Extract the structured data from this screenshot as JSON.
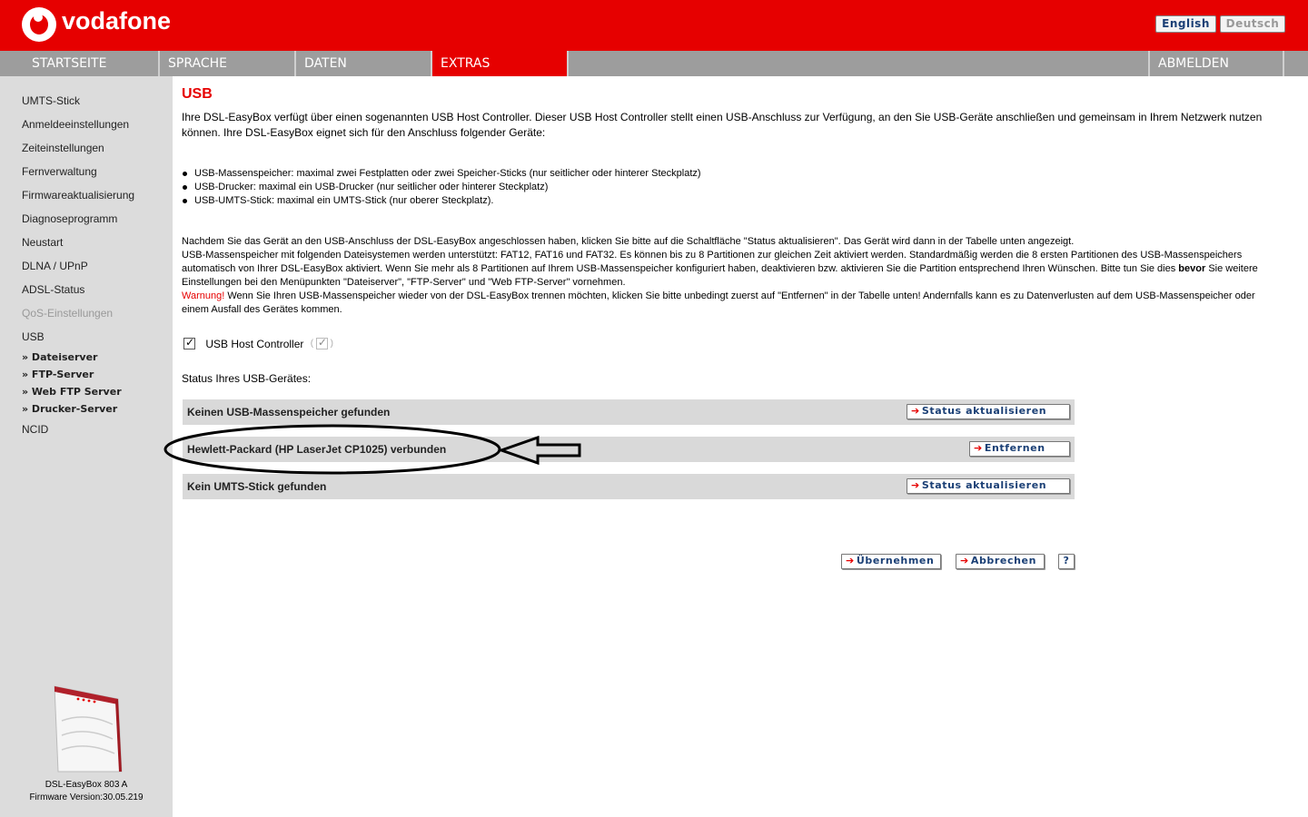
{
  "header": {
    "brand": "vodafone",
    "lang_en": "English",
    "lang_de": "Deutsch"
  },
  "nav": {
    "items": [
      "STARTSEITE",
      "SPRACHE",
      "DATEN",
      "EXTRAS"
    ],
    "active": "EXTRAS",
    "logout": "ABMELDEN"
  },
  "sidebar": {
    "items": [
      "UMTS-Stick",
      "Anmeldeeinstellungen",
      "Zeiteinstellungen",
      "Fernverwaltung",
      "Firmwareaktualisierung",
      "Diagnoseprogramm",
      "Neustart",
      "DLNA / UPnP",
      "ADSL-Status",
      "QoS-Einstellungen",
      "USB"
    ],
    "disabled_item": "QoS-Einstellungen",
    "subitems": [
      "» Dateiserver",
      "» FTP-Server",
      "» Web FTP Server",
      "» Drucker-Server"
    ],
    "last_item": "NCID",
    "device_name": "DSL-EasyBox 803 A",
    "firmware": "Firmware Version:30.05.219"
  },
  "main": {
    "title": "USB",
    "intro": "Ihre DSL-EasyBox verfügt über einen sogenannten USB Host Controller. Dieser USB Host Controller stellt einen USB-Anschluss zur Verfügung, an den Sie USB-Geräte anschließen und gemeinsam in Ihrem Netzwerk nutzen können. Ihre DSL-EasyBox eignet sich für den Anschluss folgender Geräte:",
    "bullets": [
      "USB-Massenspeicher: maximal zwei Festplatten oder zwei Speicher-Sticks (nur seitlicher oder hinterer Steckplatz)",
      "USB-Drucker: maximal ein USB-Drucker (nur seitlicher oder hinterer Steckplatz)",
      "USB-UMTS-Stick: maximal ein UMTS-Stick (nur oberer Steckplatz)."
    ],
    "info_1": "Nachdem Sie das Gerät an den USB-Anschluss der DSL-EasyBox angeschlossen haben, klicken Sie bitte auf die Schaltfläche \"Status aktualisieren\". Das Gerät wird dann in der Tabelle unten angezeigt.",
    "info_2a": "USB-Massenspeicher mit folgenden Dateisystemen werden unterstützt: FAT12, FAT16 und FAT32. Es können bis zu 8 Partitionen zur gleichen Zeit aktiviert werden. Standardmäßig werden die 8 ersten Partitionen des USB-Massenspeichers automatisch von Ihrer DSL-EasyBox aktiviert. Wenn Sie mehr als 8 Partitionen auf Ihrem USB-Massenspeicher konfiguriert haben, deaktivieren bzw. aktivieren Sie die Partition entsprechend Ihren Wünschen. Bitte tun Sie dies ",
    "info_2_bold": "bevor",
    "info_2b": " Sie weitere Einstellungen bei den Menüpunkten \"Dateiserver\", \"FTP-Server\" und \"Web FTP-Server\" vornehmen.",
    "warning_label": "Warnung!",
    "warning_text": " Wenn Sie Ihren USB-Massenspeicher wieder von der DSL-EasyBox trennen möchten, klicken Sie bitte unbedingt zuerst auf \"Entfernen\" in der Tabelle unten! Andernfalls kann es zu Datenverlusten auf dem USB-Massenspeicher oder einem Ausfall des Gerätes kommen.",
    "controller_label": "USB Host Controller",
    "controller_paren_open": "(",
    "controller_paren_close": ")",
    "status_label": "Status Ihres USB-Gerätes:",
    "rows": [
      {
        "text": "Keinen USB-Massenspeicher gefunden",
        "button": "Status aktualisieren"
      },
      {
        "text": "Hewlett-Packard (HP LaserJet CP1025) verbunden",
        "button": "Entfernen"
      },
      {
        "text": "Kein UMTS-Stick gefunden",
        "button": "Status aktualisieren"
      }
    ],
    "apply": "Übernehmen",
    "cancel": "Abbrechen",
    "help": "?"
  },
  "colors": {
    "brand_red": "#e60000",
    "nav_gray": "#9d9d9d",
    "sidebar_bg": "#dcdcdc",
    "row_bg": "#d9d9d9",
    "button_text": "#1a3f75"
  },
  "icons": {
    "logo": "vodafone-speechmark-icon",
    "button_arrow": "arrow-right-icon",
    "annotation": "hand-drawn-ellipse-and-arrow"
  }
}
